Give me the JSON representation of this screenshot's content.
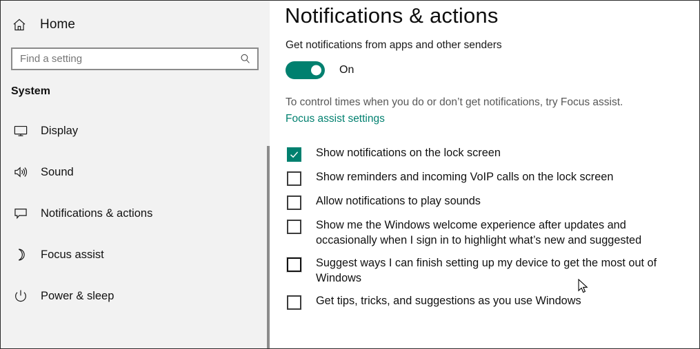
{
  "sidebar": {
    "home": {
      "label": "Home",
      "icon": "home-icon"
    },
    "search": {
      "placeholder": "Find a setting",
      "value": "",
      "icon": "search-icon"
    },
    "group_title": "System",
    "items": [
      {
        "label": "Display",
        "icon": "monitor-icon"
      },
      {
        "label": "Sound",
        "icon": "speaker-icon"
      },
      {
        "label": "Notifications & actions",
        "icon": "chat-bubble-icon"
      },
      {
        "label": "Focus assist",
        "icon": "moon-icon"
      },
      {
        "label": "Power & sleep",
        "icon": "power-icon"
      }
    ]
  },
  "content": {
    "title": "Notifications & actions",
    "subtitle": "Get notifications from apps and other senders",
    "toggle": {
      "label": "On",
      "state": "on"
    },
    "hint_text": "To control times when you do or don’t get notifications, try Focus assist.",
    "hint_link": "Focus assist settings",
    "checkboxes": [
      {
        "label": "Show notifications on the lock screen",
        "checked": true,
        "hovered": false
      },
      {
        "label": "Show reminders and incoming VoIP calls on the lock screen",
        "checked": false,
        "hovered": false
      },
      {
        "label": "Allow notifications to play sounds",
        "checked": false,
        "hovered": false
      },
      {
        "label": "Show me the Windows welcome experience after updates and occasionally when I sign in to highlight what’s new and suggested",
        "checked": false,
        "hovered": false
      },
      {
        "label": "Suggest ways I can finish setting up my device to get the most out of Windows",
        "checked": false,
        "hovered": true
      },
      {
        "label": "Get tips, tricks, and suggestions as you use Windows",
        "checked": false,
        "hovered": false
      }
    ]
  },
  "colors": {
    "accent": "#00806f",
    "sidebar_bg": "#f2f2f2",
    "content_bg": "#ffffff",
    "text": "#111111",
    "muted_text": "#585858",
    "scrollbar": "#8c8c8c"
  }
}
